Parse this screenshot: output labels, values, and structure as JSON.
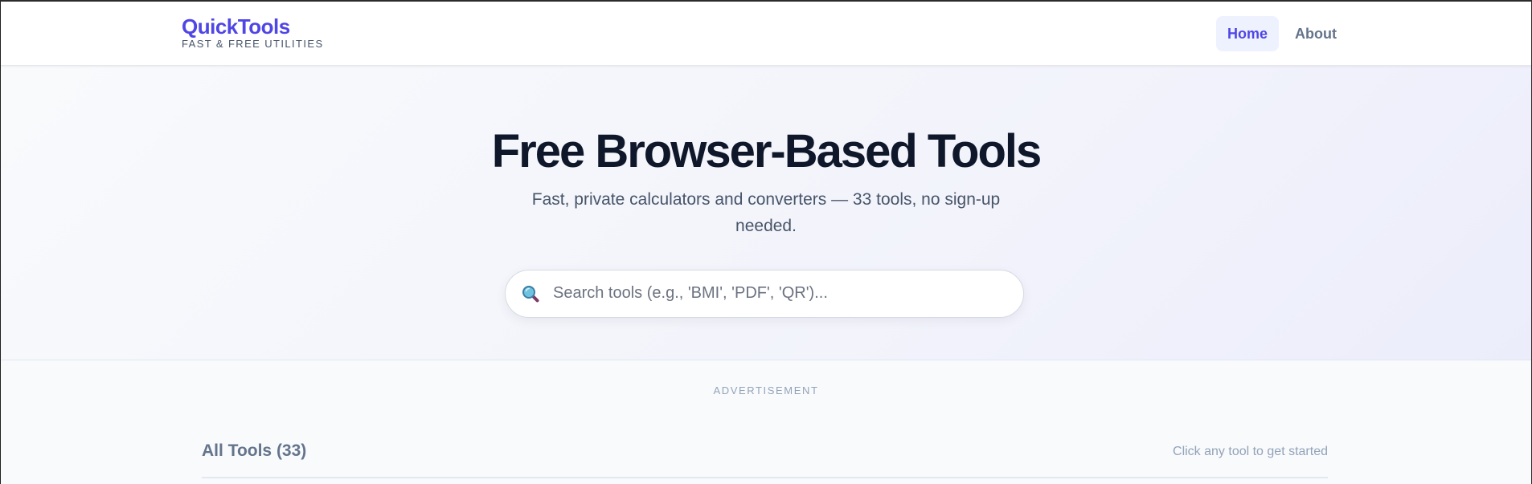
{
  "brand": {
    "name": "QuickTools",
    "tagline": "FAST & FREE UTILITIES"
  },
  "nav": {
    "items": [
      {
        "label": "Home",
        "active": true
      },
      {
        "label": "About",
        "active": false
      }
    ]
  },
  "hero": {
    "title": "Free Browser-Based Tools",
    "subtitle": "Fast, private calculators and converters — 33 tools, no sign-up needed."
  },
  "search": {
    "icon": "magnifying-glass-icon",
    "placeholder": "Search tools (e.g., 'BMI', 'PDF', 'QR')...",
    "value": ""
  },
  "ad": {
    "label": "ADVERTISEMENT"
  },
  "tools": {
    "title": "All Tools (33)",
    "hint": "Click any tool to get started"
  },
  "colors": {
    "accent": "#4f46e5",
    "heading": "#0f172a",
    "muted": "#64748b"
  }
}
